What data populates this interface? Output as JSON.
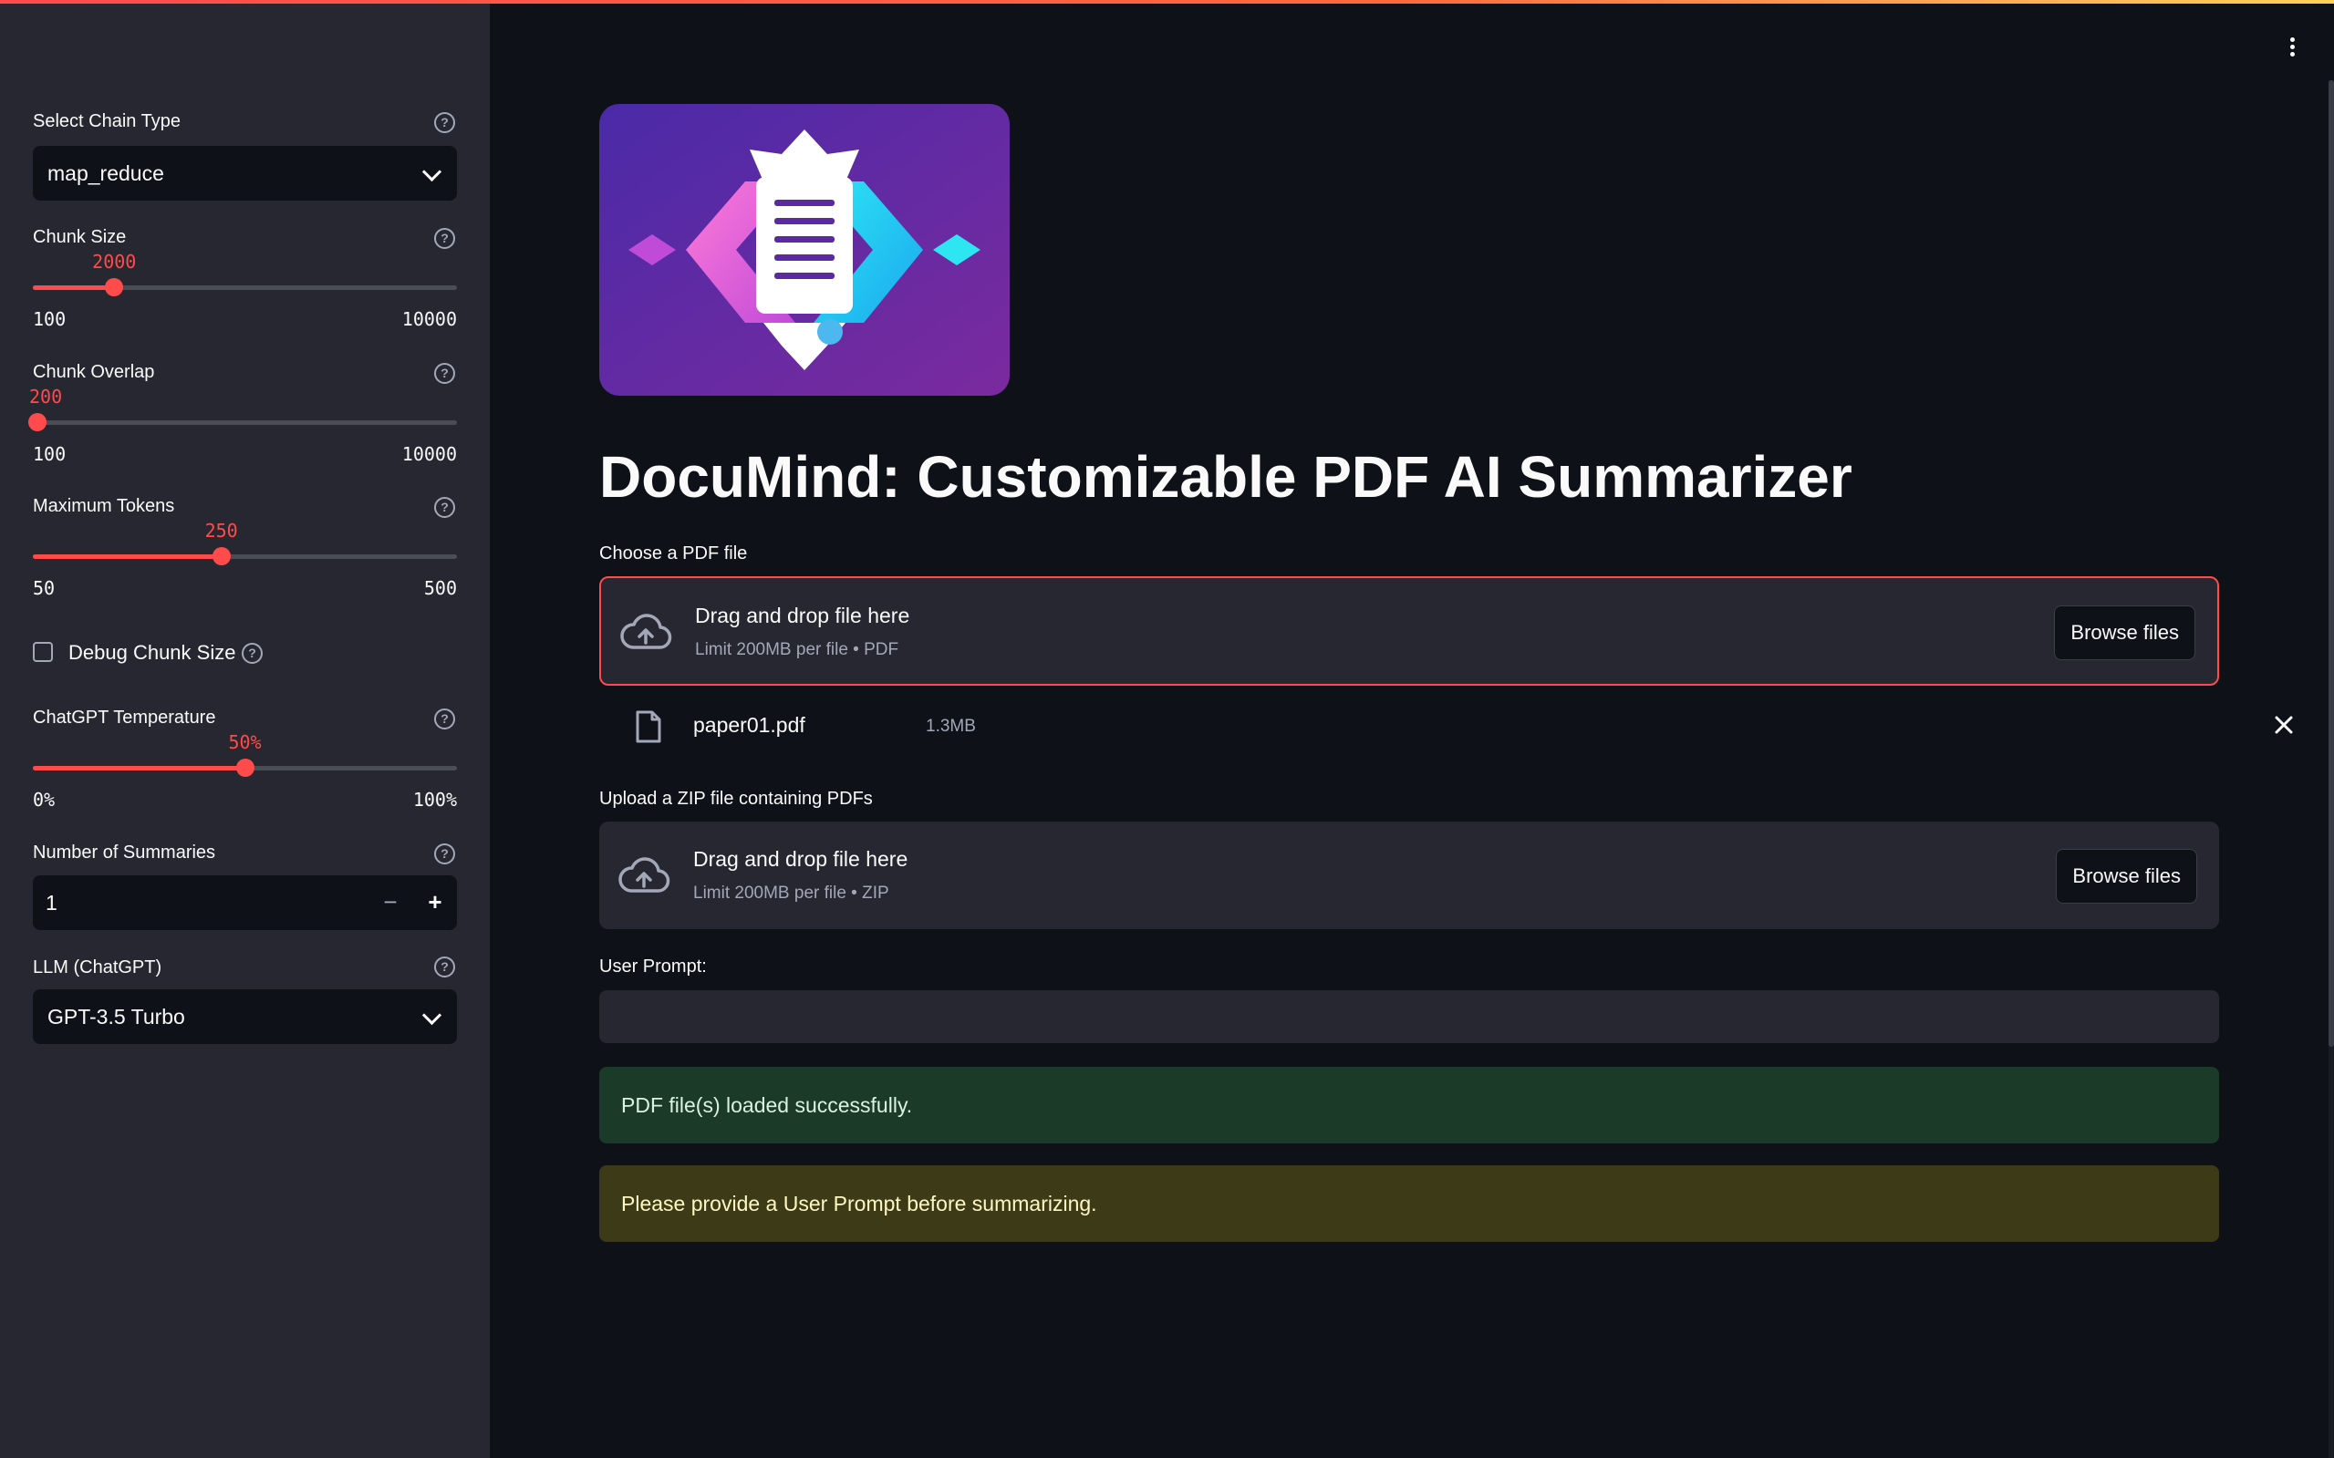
{
  "sidebar": {
    "chain_type": {
      "label": "Select Chain Type",
      "value": "map_reduce"
    },
    "chunk_size": {
      "label": "Chunk Size",
      "value": "2000",
      "value_num": 2000,
      "min": "100",
      "max": "10000",
      "min_num": 100,
      "max_num": 10000
    },
    "chunk_overlap": {
      "label": "Chunk Overlap",
      "value": "200",
      "value_num": 200,
      "min": "100",
      "max": "10000",
      "min_num": 100,
      "max_num": 10000
    },
    "max_tokens": {
      "label": "Maximum Tokens",
      "value": "250",
      "value_num": 250,
      "min": "50",
      "max": "500",
      "min_num": 50,
      "max_num": 500
    },
    "debug": {
      "label": "Debug Chunk Size",
      "checked": false
    },
    "temperature": {
      "label": "ChatGPT Temperature",
      "value": "50%",
      "value_num": 50,
      "min": "0%",
      "max": "100%",
      "min_num": 0,
      "max_num": 100
    },
    "num_summaries": {
      "label": "Number of Summaries",
      "value": "1",
      "minus": "−",
      "plus": "+"
    },
    "llm": {
      "label": "LLM (ChatGPT)",
      "value": "GPT-3.5 Turbo"
    }
  },
  "main": {
    "title": "DocuMind: Customizable PDF AI Summarizer",
    "pdf_upload": {
      "label": "Choose a PDF file",
      "drop_text": "Drag and drop file here",
      "limit_text": "Limit 200MB per file • PDF",
      "button": "Browse files"
    },
    "uploaded_file": {
      "name": "paper01.pdf",
      "size": "1.3MB"
    },
    "zip_upload": {
      "label": "Upload a ZIP file containing PDFs",
      "drop_text": "Drag and drop file here",
      "limit_text": "Limit 200MB per file • ZIP",
      "button": "Browse files"
    },
    "user_prompt": {
      "label": "User Prompt:",
      "value": ""
    },
    "alerts": {
      "success": "PDF file(s) loaded successfully.",
      "warning": "Please provide a User Prompt before summarizing."
    }
  },
  "icons": {
    "help": "question-circle-icon",
    "chevron": "chevron-down-icon",
    "upload": "cloud-upload-icon",
    "file": "file-icon",
    "close": "close-icon",
    "menu": "kebab-menu-icon"
  },
  "colors": {
    "accent": "#ff4b4b",
    "background": "#0e1117",
    "sidebar": "#262730",
    "success_bg": "#1b3a28",
    "warning_bg": "#3d3b17"
  }
}
